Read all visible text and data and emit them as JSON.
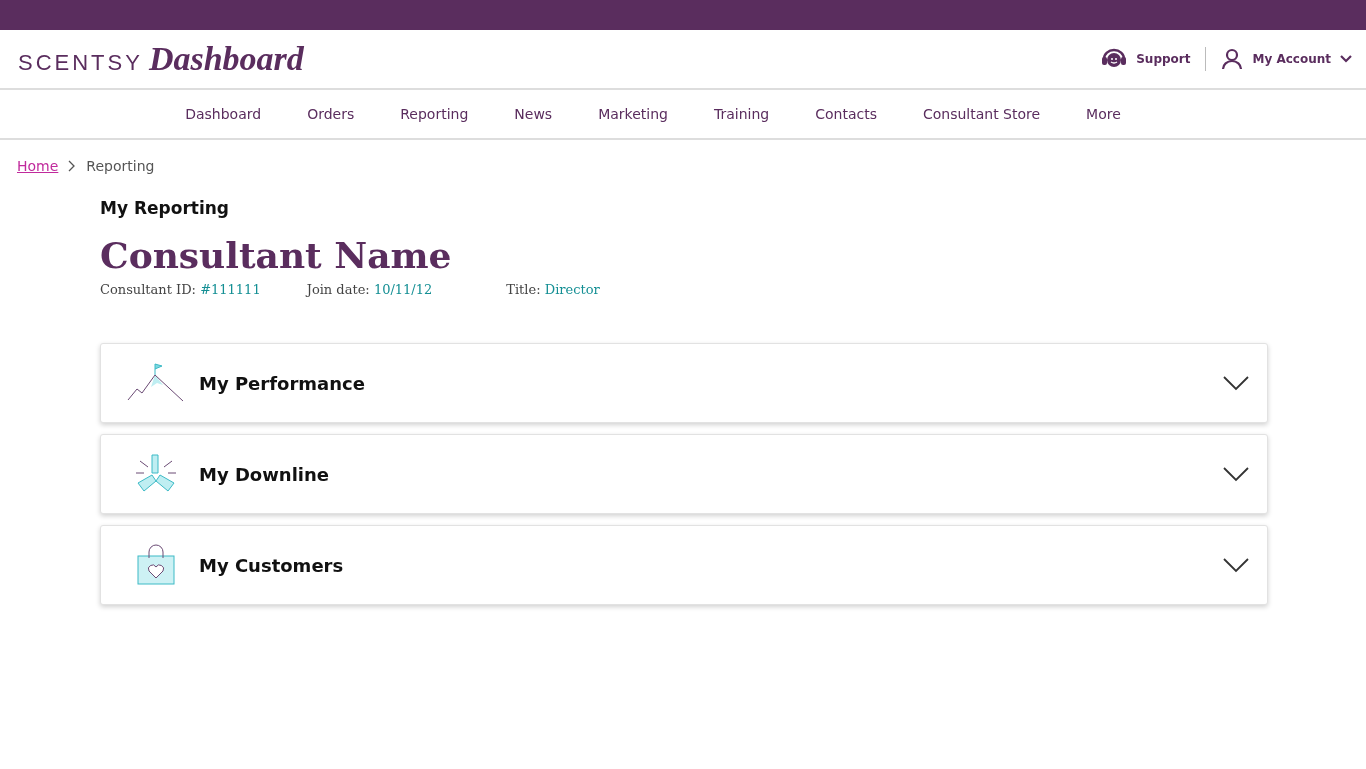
{
  "logo": {
    "brand": "SCENTSY",
    "product": "Dashboard"
  },
  "header_links": {
    "support": "Support",
    "account": "My Account"
  },
  "nav": [
    {
      "label": "Dashboard"
    },
    {
      "label": "Orders"
    },
    {
      "label": "Reporting"
    },
    {
      "label": "News"
    },
    {
      "label": "Marketing"
    },
    {
      "label": "Training"
    },
    {
      "label": "Contacts"
    },
    {
      "label": "Consultant Store"
    },
    {
      "label": "More"
    }
  ],
  "breadcrumb": {
    "home": "Home",
    "current": "Reporting"
  },
  "section_title": "My Reporting",
  "consultant": {
    "name": "Consultant Name",
    "fields": [
      {
        "label": "Consultant ID:",
        "value": "#111111"
      },
      {
        "label": "Join date:",
        "value": "10/11/12"
      },
      {
        "label": "Title:",
        "value": "Director"
      }
    ]
  },
  "panels": [
    {
      "kind": "mountain",
      "title": "My Performance",
      "expanded": false
    },
    {
      "kind": "hands",
      "title": "My Downline",
      "expanded": false
    },
    {
      "kind": "bag",
      "title": "My Customers",
      "expanded": false
    }
  ]
}
